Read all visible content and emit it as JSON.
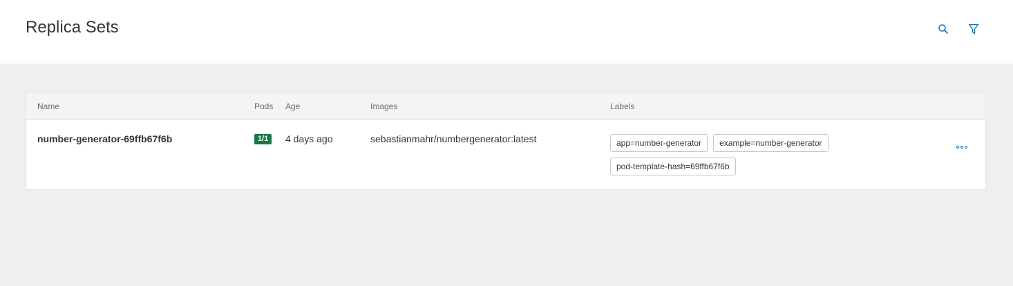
{
  "header": {
    "title": "Replica Sets",
    "search_icon": "search-icon",
    "filter_icon": "filter-icon",
    "accent_color": "#0a6ed1"
  },
  "table": {
    "columns": {
      "name": "Name",
      "pods": "Pods",
      "age": "Age",
      "images": "Images",
      "labels": "Labels"
    },
    "rows": [
      {
        "name": "number-generator-69ffb67f6b",
        "pods": "1/1",
        "pods_status_color": "#107e3e",
        "age": "4 days ago",
        "image": "sebastianmahr/numbergenerator:latest",
        "labels": [
          "app=number-generator",
          "example=number-generator",
          "pod-template-hash=69ffb67f6b"
        ],
        "menu_icon": "overflow-menu-icon"
      }
    ]
  }
}
